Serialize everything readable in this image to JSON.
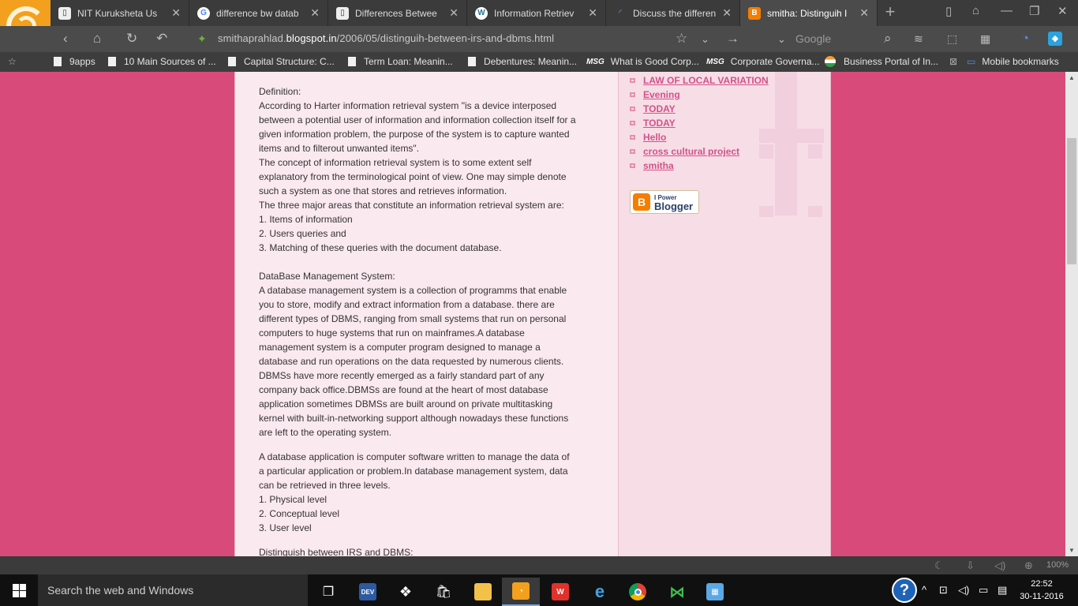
{
  "tabs": [
    {
      "title": "NIT Kuruksheta Us",
      "icon": "document-icon",
      "active": false
    },
    {
      "title": "difference bw datab",
      "icon": "google-icon",
      "active": false
    },
    {
      "title": "Differences Betwee",
      "icon": "document-icon",
      "active": false
    },
    {
      "title": "Information Retriev",
      "icon": "wordpress-icon",
      "active": false
    },
    {
      "title": "Discuss the differen",
      "icon": "loading-icon",
      "active": false
    },
    {
      "title": "smitha: Distinguih I",
      "icon": "blogger-icon",
      "active": true
    }
  ],
  "address": {
    "url_prefix": "smithaprahlad.",
    "url_domain": "blogspot.in",
    "url_path": "/2006/05/distinguih-between-irs-and-dbms.html",
    "search_engine_label": "g",
    "search_placeholder": "Google"
  },
  "bookmarks": [
    "9apps",
    "10 Main Sources of ...",
    "Capital Structure: C...",
    "Term Loan: Meanin...",
    "Debentures: Meanin...",
    "What is Good Corp...",
    "Corporate Governa...",
    "Business Portal of In...",
    "Mobile bookmarks"
  ],
  "article": {
    "para1": [
      "Definition:",
      "According to Harter information retrieval system \"is a device interposed",
      "between a potential user of information and information collection itself for a",
      "given information problem, the purpose of the system is to capture wanted",
      "items and to filterout unwanted items\".",
      "The concept of information retrieval system is to some extent self",
      "explanatory from the terminological point of view. One may simple denote",
      "such a system as one that stores and retrieves information.",
      "The three major areas that constitute an information retrieval system are:",
      "1. Items of information",
      "2. Users queries and",
      "3. Matching of these queries with the document database."
    ],
    "para2": [
      "DataBase Management System:",
      "A database management system is a collection of programms that enable",
      "you to store, modify and extract information from a database. there are",
      "different types of DBMS, ranging from small systems that run on personal",
      "computers to huge systems that run on mainframes.A database",
      "management system is a computer program designed to manage a",
      "database and run operations on the data requested by numerous clients.",
      "DBMSs have more recently emerged as a fairly standard part of any",
      "company back office.DBMSs are found at the heart of most database",
      "application sometimes DBMSs are built around on private multitasking",
      "kernel with built-in-networking support although nowadays these functions",
      "are left to the operating system."
    ],
    "para3": [
      "A database application is computer software written to manage the data of",
      "a particular application or problem.In database management system, data",
      "can be retrieved in three levels.",
      "1. Physical level",
      "2. Conceptual level",
      "3. User level"
    ],
    "para4": [
      "Distinguish between IRS and DBMS:"
    ]
  },
  "sidebar_links": [
    "LAW OF LOCAL VARIATION",
    "Evening",
    "TODAY",
    "TODAY",
    "Hello",
    "cross cultural project",
    "smitha"
  ],
  "blogger_badge": {
    "small": "I Power",
    "large": "Blogger",
    "icon": "blogger-icon"
  },
  "statusbar": {
    "zoom": "100%"
  },
  "taskbar": {
    "search_placeholder": "Search the web and Windows",
    "time": "22:52",
    "date": "30-11-2016"
  },
  "colors": {
    "page_background": "#d84a7a",
    "content_background": "#fbe9f0",
    "sidebar_background": "#f7dde6",
    "link_color": "#d2528a"
  }
}
